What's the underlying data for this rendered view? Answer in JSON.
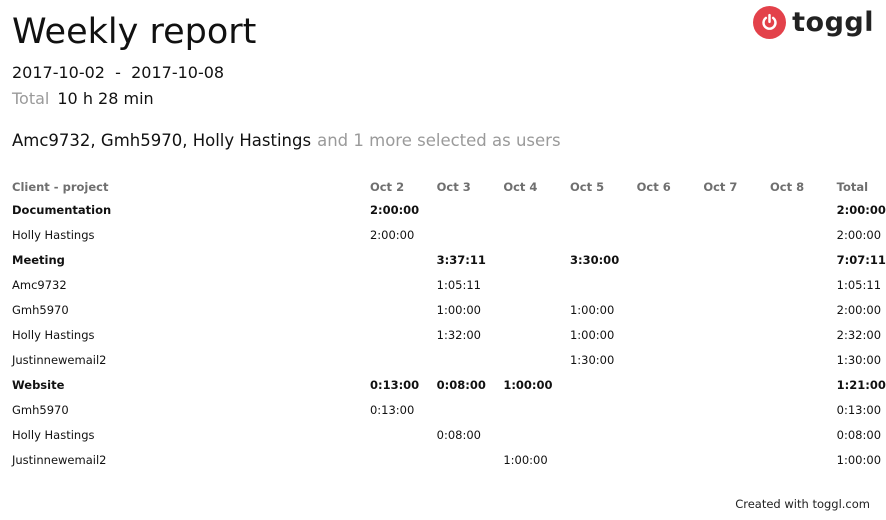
{
  "report": {
    "title": "Weekly report",
    "date_range": "2017-10-02  -  2017-10-08",
    "total_label": "Total",
    "total_value": "10 h 28 min",
    "users_selected": "Amc9732, Gmh5970, Holly Hastings",
    "users_more": "and 1 more selected as users",
    "footer": "Created with toggl.com"
  },
  "logo": {
    "text": "toggl",
    "brand_color": "#e3414a",
    "icon": "power-icon"
  },
  "table": {
    "headers": [
      "Client - project",
      "Oct 2",
      "Oct 3",
      "Oct 4",
      "Oct 5",
      "Oct 6",
      "Oct 7",
      "Oct 8",
      "Total"
    ],
    "rows": [
      {
        "type": "group",
        "cells": [
          "Documentation",
          "2:00:00",
          "",
          "",
          "",
          "",
          "",
          "",
          "2:00:00"
        ]
      },
      {
        "type": "user",
        "cells": [
          "Holly Hastings",
          "2:00:00",
          "",
          "",
          "",
          "",
          "",
          "",
          "2:00:00"
        ]
      },
      {
        "type": "group",
        "cells": [
          "Meeting",
          "",
          "3:37:11",
          "",
          "3:30:00",
          "",
          "",
          "",
          "7:07:11"
        ]
      },
      {
        "type": "user",
        "cells": [
          "Amc9732",
          "",
          "1:05:11",
          "",
          "",
          "",
          "",
          "",
          "1:05:11"
        ]
      },
      {
        "type": "user",
        "cells": [
          "Gmh5970",
          "",
          "1:00:00",
          "",
          "1:00:00",
          "",
          "",
          "",
          "2:00:00"
        ]
      },
      {
        "type": "user",
        "cells": [
          "Holly Hastings",
          "",
          "1:32:00",
          "",
          "1:00:00",
          "",
          "",
          "",
          "2:32:00"
        ]
      },
      {
        "type": "user",
        "cells": [
          "Justinnewemail2",
          "",
          "",
          "",
          "1:30:00",
          "",
          "",
          "",
          "1:30:00"
        ]
      },
      {
        "type": "group",
        "cells": [
          "Website",
          "0:13:00",
          "0:08:00",
          "1:00:00",
          "",
          "",
          "",
          "",
          "1:21:00"
        ]
      },
      {
        "type": "user",
        "cells": [
          "Gmh5970",
          "0:13:00",
          "",
          "",
          "",
          "",
          "",
          "",
          "0:13:00"
        ]
      },
      {
        "type": "user",
        "cells": [
          "Holly Hastings",
          "",
          "0:08:00",
          "",
          "",
          "",
          "",
          "",
          "0:08:00"
        ]
      },
      {
        "type": "user",
        "cells": [
          "Justinnewemail2",
          "",
          "",
          "1:00:00",
          "",
          "",
          "",
          "",
          "1:00:00"
        ]
      }
    ]
  }
}
